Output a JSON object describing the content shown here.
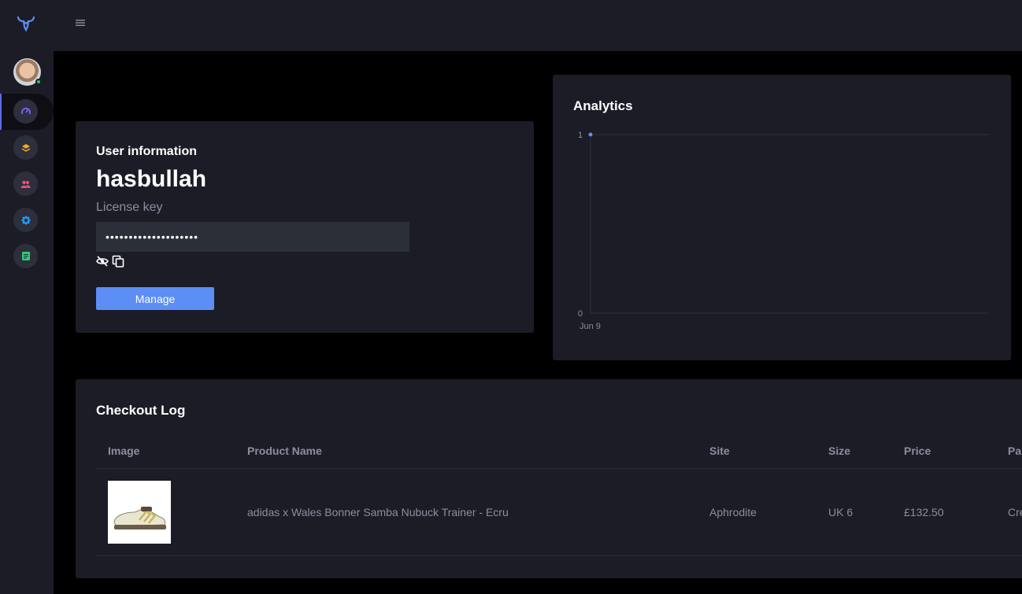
{
  "sidebar": {
    "items": [
      {
        "icon": "dashboard-gauge-icon",
        "color": "#7b61ff",
        "active": true
      },
      {
        "icon": "layers-icon",
        "color": "#f5a623"
      },
      {
        "icon": "users-icon",
        "color": "#f0506e"
      },
      {
        "icon": "settings-gear-icon",
        "color": "#1e9bf0"
      },
      {
        "icon": "document-icon",
        "color": "#2ecc71"
      }
    ]
  },
  "user_info": {
    "title": "User information",
    "username": "hasbullah",
    "license_label": "License key",
    "license_value": "••••••••••••••••••••",
    "manage_label": "Manage"
  },
  "analytics": {
    "title": "Analytics",
    "chart_data": {
      "type": "line",
      "x": [
        "Jun 9"
      ],
      "series": [
        {
          "values": [
            1
          ]
        }
      ],
      "ylim": [
        0,
        1
      ],
      "yticks": [
        "1",
        "0"
      ],
      "xticks": [
        "Jun 9"
      ],
      "grid": true,
      "color": "#5d8ef6"
    }
  },
  "checkout": {
    "title": "Checkout Log",
    "columns": [
      "Image",
      "Product Name",
      "Site",
      "Size",
      "Price",
      "Pa"
    ],
    "rows": [
      {
        "product": "adidas x Wales Bonner Samba Nubuck Trainer - Ecru",
        "site": "Aphrodite",
        "size": "UK 6",
        "price": "£132.50",
        "payment": "Cre"
      }
    ]
  }
}
